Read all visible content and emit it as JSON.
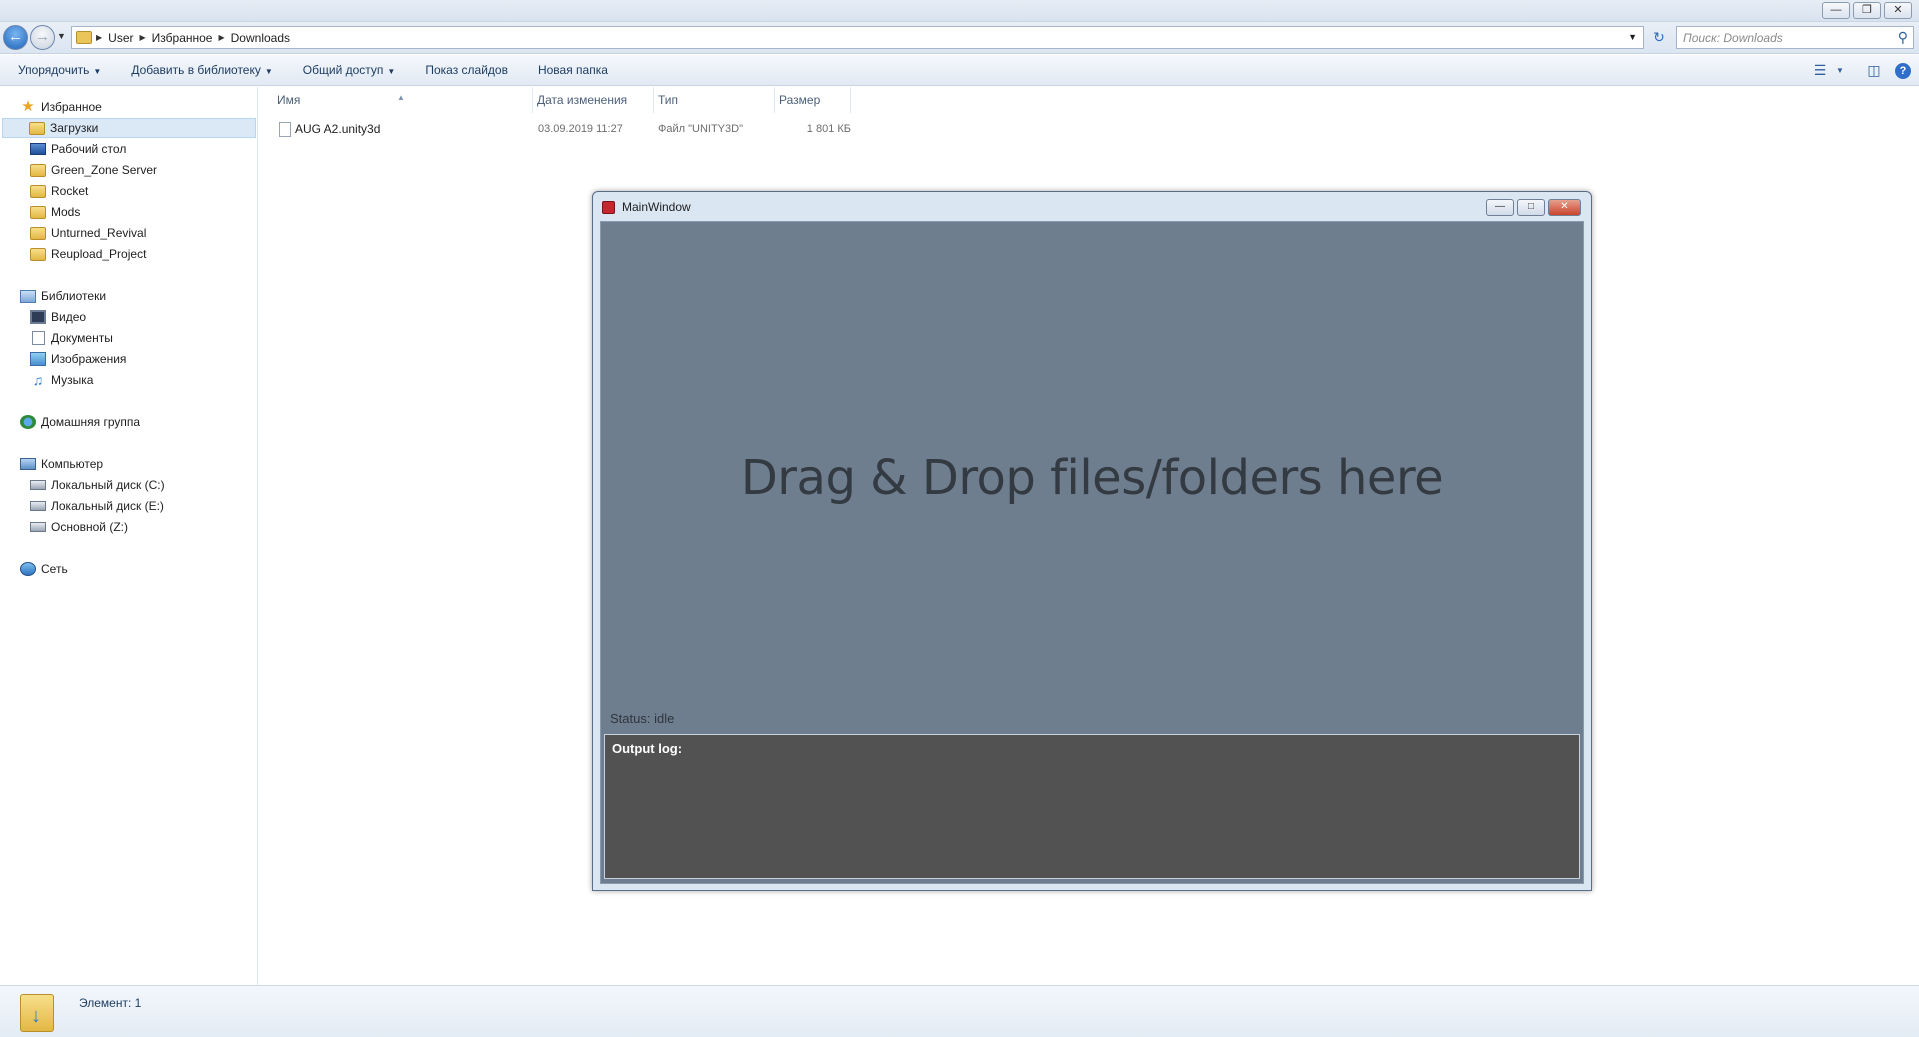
{
  "explorer": {
    "breadcrumb": [
      "User",
      "Избранное",
      "Downloads"
    ],
    "search_placeholder": "Поиск: Downloads",
    "toolbar": {
      "organize": "Упорядочить",
      "add_to_library": "Добавить в библиотеку",
      "share": "Общий доступ",
      "slideshow": "Показ слайдов",
      "new_folder": "Новая папка"
    },
    "nav": {
      "favorites": "Избранное",
      "favorites_items": [
        "Загрузки",
        "Рабочий стол",
        "Green_Zone Server",
        "Rocket",
        "Mods",
        "Unturned_Revival",
        "Reupload_Project"
      ],
      "libraries": "Библиотеки",
      "library_items": [
        "Видео",
        "Документы",
        "Изображения",
        "Музыка"
      ],
      "homegroup": "Домашняя группа",
      "computer": "Компьютер",
      "computer_items": [
        "Локальный диск (C:)",
        "Локальный диск (E:)",
        "Основной (Z:)"
      ],
      "network": "Сеть"
    },
    "columns": {
      "name": "Имя",
      "modified": "Дата изменения",
      "type": "Тип",
      "size": "Размер"
    },
    "files": [
      {
        "name": "AUG A2.unity3d",
        "modified": "03.09.2019 11:27",
        "type": "Файл \"UNITY3D\"",
        "size": "1 801 КБ"
      }
    ],
    "status": "Элемент: 1"
  },
  "mainwindow": {
    "title": "MainWindow",
    "drop_label": "Drag & Drop files/folders here",
    "status": "Status: idle",
    "output_label": "Output log:",
    "colors": {
      "client_bg": "#6f7e8f",
      "log_bg": "#525252"
    }
  }
}
